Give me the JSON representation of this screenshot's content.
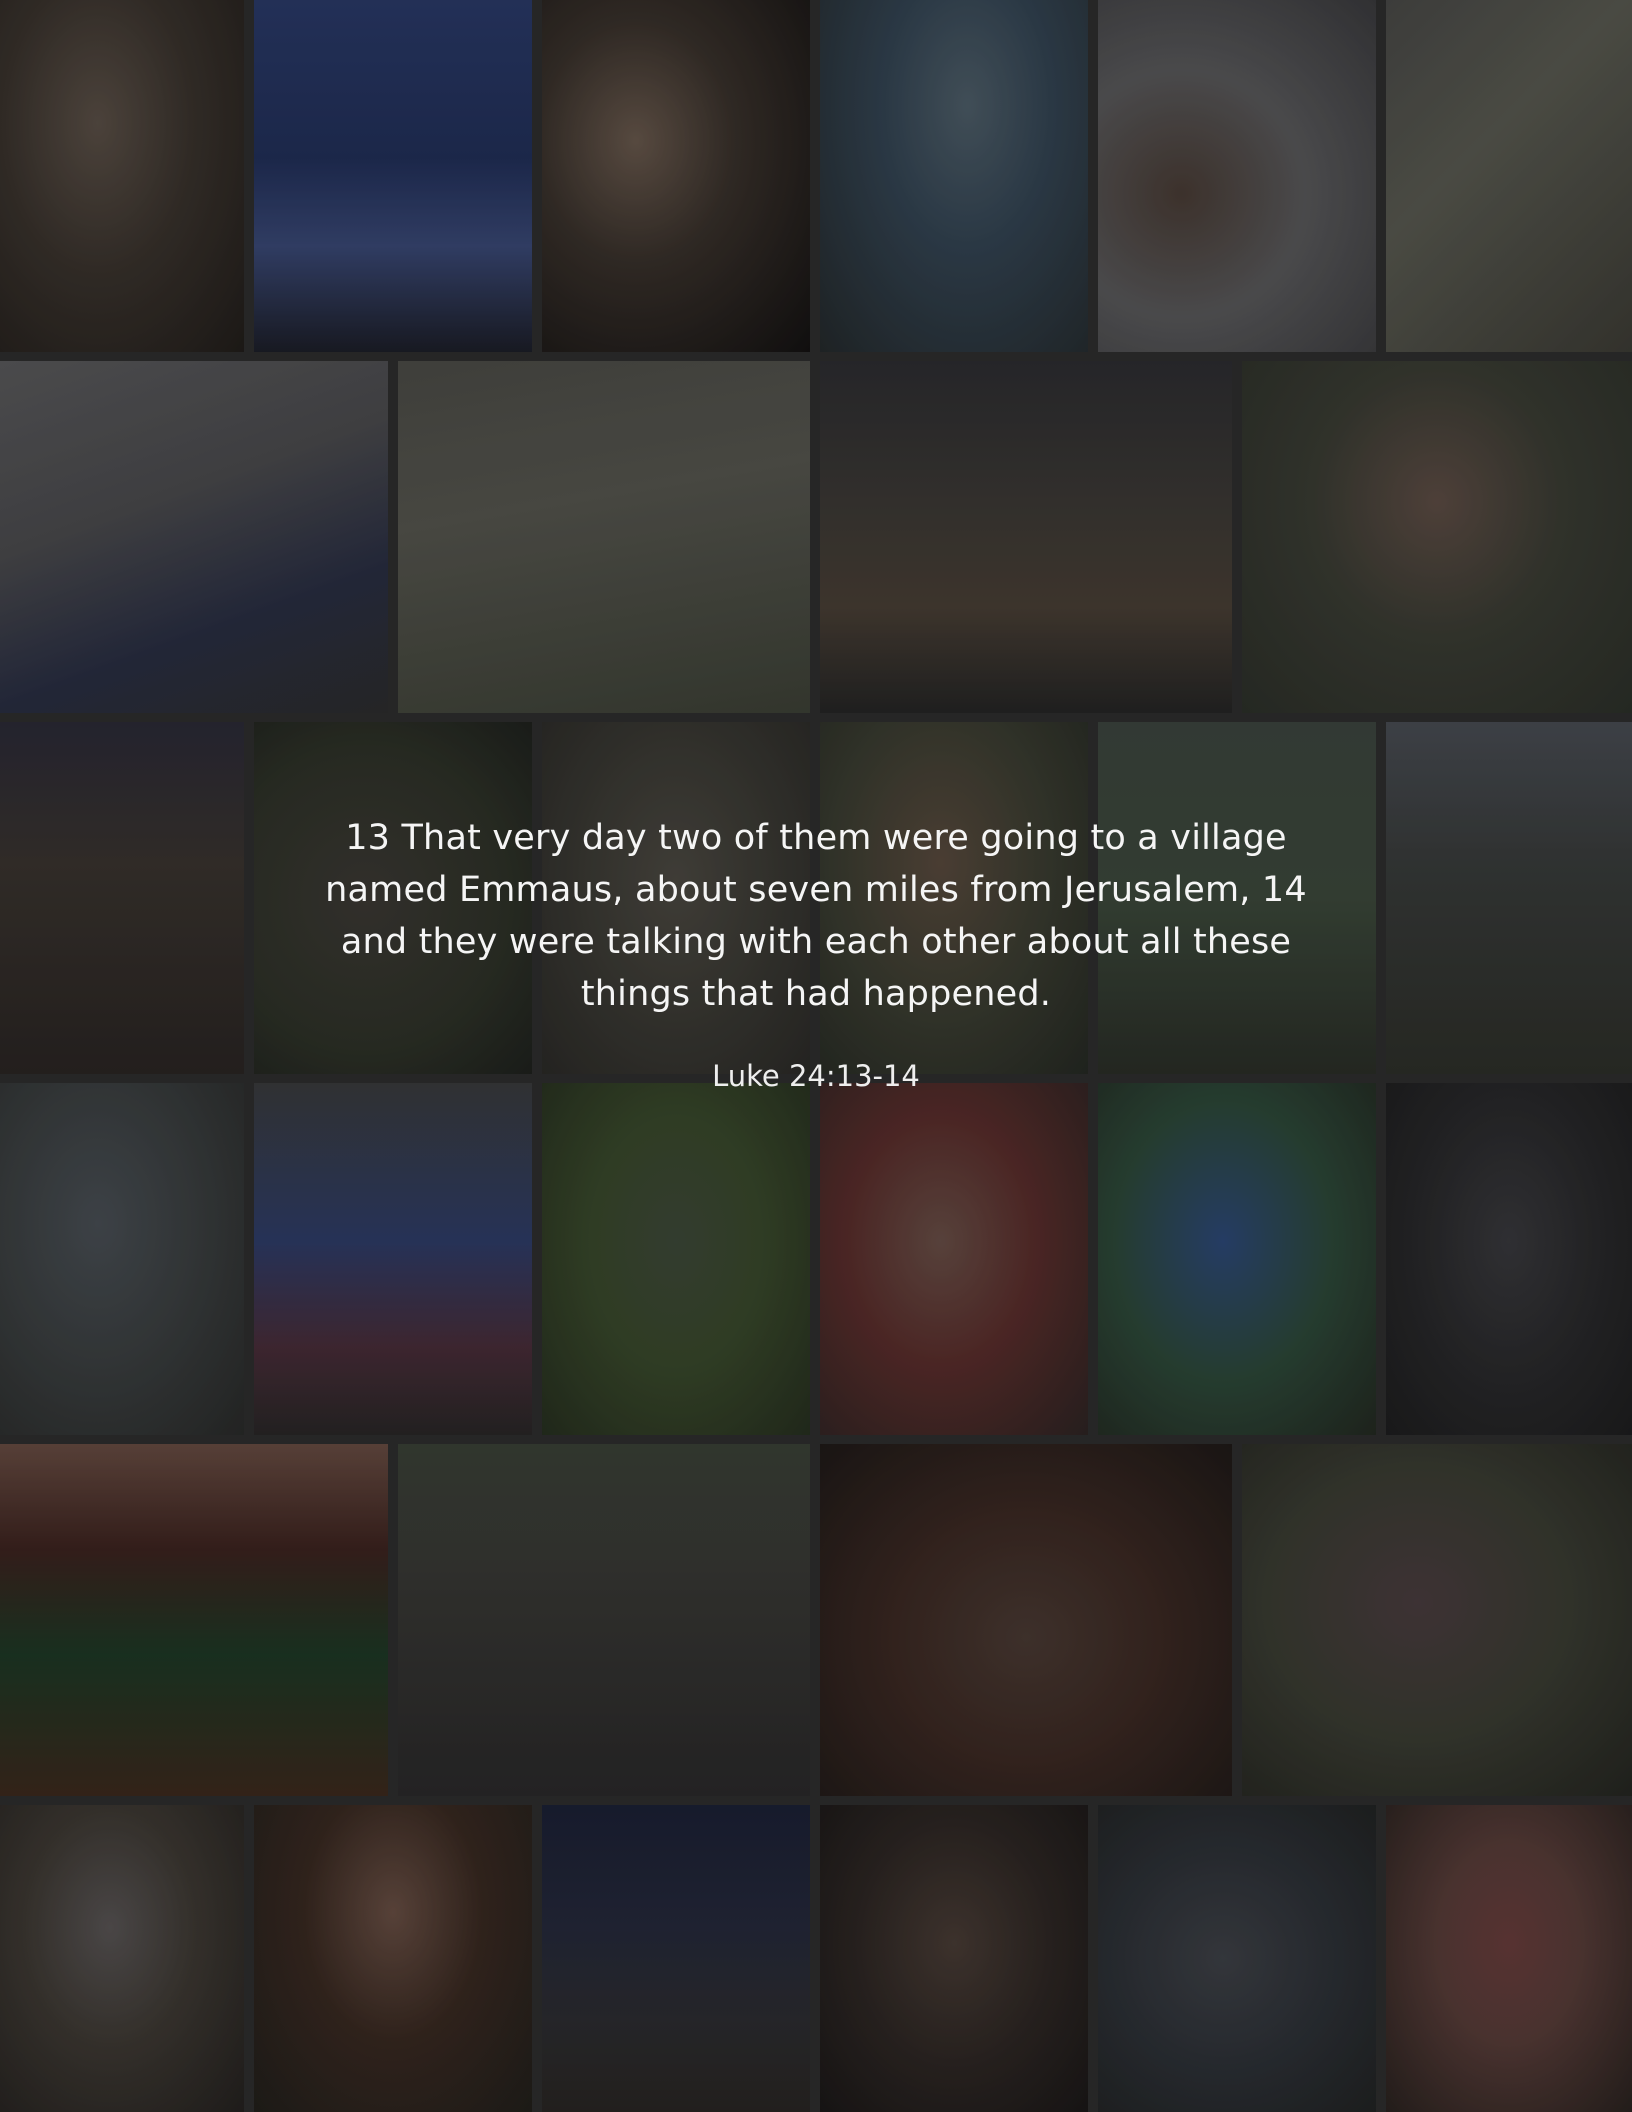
{
  "verse": {
    "text": "13 That very day two of them were going to a village named Emmaus, about seven miles from Jerusalem, 14 and they were talking with each other about all these things that had happened.",
    "reference": "Luke 24:13-14"
  },
  "gallery": {
    "rows": [
      {
        "columns": 6,
        "tiles": [
          "smiling-man-photo",
          "kids-on-stage-photo",
          "women-laughing-photo",
          "man-cheering-photo",
          "youth-group-photo",
          "volunteers-photo"
        ]
      },
      {
        "columns": 4,
        "tiles": [
          "man-building-photo",
          "woman-with-child-photo",
          "group-photo",
          "men-greeting-photo"
        ]
      },
      {
        "columns": 6,
        "tiles": [
          "family-stage-photo",
          "outdoor-group-photo",
          "woman-gardening-photo",
          "man-kneeling-photo",
          "smiling-child-photo",
          "work-team-photo"
        ]
      },
      {
        "columns": 6,
        "tiles": [
          "family-walking-photo",
          "kids-camp-photo",
          "yard-cleanup-photo",
          "women-candy-cane-photo",
          "youth-cheering-photo",
          "crowd-photo"
        ]
      },
      {
        "columns": 4,
        "tiles": [
          "worship-band-photo",
          "outdoor-service-photo",
          "living-room-gathering-photo",
          "picnic-photo"
        ]
      },
      {
        "columns": 6,
        "tiles": [
          "congregation-photo",
          "girl-with-book-photo",
          "kids-performance-photo",
          "young-men-group-photo",
          "kids-classroom-photo",
          "women-traditional-dress-photo"
        ]
      }
    ]
  },
  "colors": {
    "background": "#2f2f2f",
    "text": "#ffffff"
  }
}
